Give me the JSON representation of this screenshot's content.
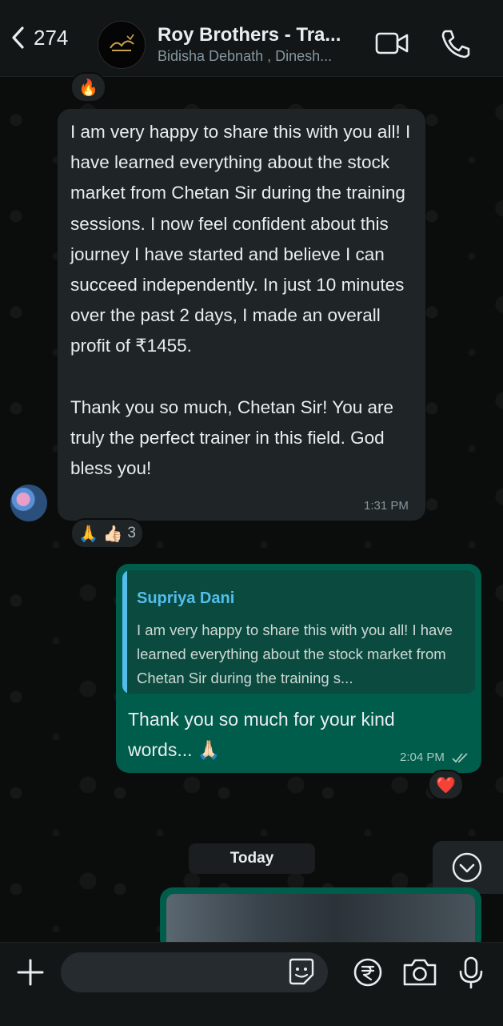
{
  "header": {
    "back_count": "274",
    "title": "Roy Brothers - Tra...",
    "participants": "Bidisha Debnath , Dinesh..."
  },
  "messages": {
    "top_reaction": "🔥",
    "incoming": {
      "text": "I am very happy to share this with you all! I have learned everything about the stock market from Chetan Sir during the training sessions. I now feel confident about this journey I have started and believe I can succeed independently. In just 10 minutes over the past 2 days, I made an overall profit of ₹1455.\n\nThank you so much, Chetan Sir! You are truly the perfect trainer in this field. God bless you!",
      "time": "1:31 PM",
      "reactions": "🙏 👍🏻",
      "reaction_count": "3"
    },
    "outgoing": {
      "quote_author": "Supriya Dani",
      "quote_text": "I am very happy to share this with you all! I have learned everything about the stock market from Chetan Sir during the training s...",
      "text": "Thank you so much for your kind words... 🙏🏻",
      "time": "2:04 PM",
      "reaction": "❤️"
    },
    "date_separator": "Today"
  },
  "colors": {
    "incoming_bubble": "#1f2426",
    "outgoing_bubble": "#005c4b",
    "quote_accent": "#53bdeb",
    "read_ticks": "#8696a0"
  }
}
